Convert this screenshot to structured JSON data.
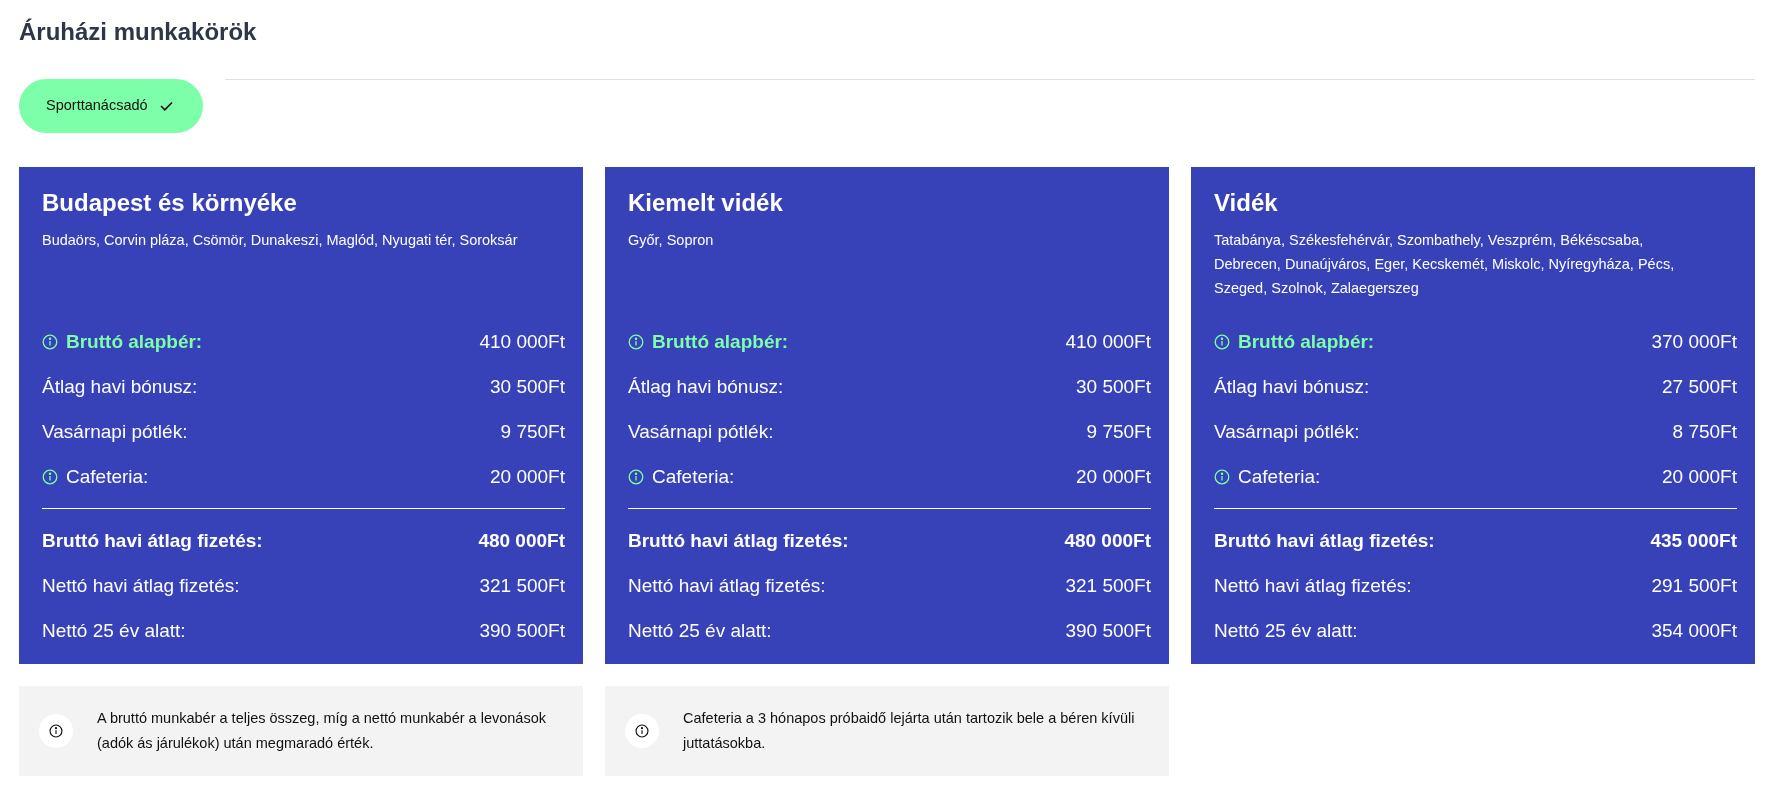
{
  "title": "Áruházi munkakörök",
  "roles": [
    {
      "label": "Sporttanácsadó",
      "selected": true
    }
  ],
  "regions": [
    {
      "name": "Budapest és környéke",
      "cities": "Budaörs, Corvin pláza, Csömör, Dunakeszi, Maglód, Nyugati tér, Soroksár",
      "rows": [
        {
          "kind": "base",
          "label": "Bruttó alapbér:",
          "value": "410 000Ft"
        },
        {
          "kind": "plain",
          "label": "Átlag havi bónusz:",
          "value": "30 500Ft"
        },
        {
          "kind": "plain",
          "label": "Vasárnapi pótlék:",
          "value": "9 750Ft"
        },
        {
          "kind": "info",
          "label": "Cafeteria:",
          "value": "20 000Ft"
        },
        {
          "kind": "total",
          "label": "Bruttó havi átlag fizetés:",
          "value": "480 000Ft"
        },
        {
          "kind": "plain",
          "label": "Nettó havi átlag fizetés:",
          "value": "321 500Ft"
        },
        {
          "kind": "plain",
          "label": "Nettó 25 év alatt:",
          "value": "390 500Ft"
        }
      ]
    },
    {
      "name": "Kiemelt vidék",
      "cities": "Győr, Sopron",
      "rows": [
        {
          "kind": "base",
          "label": "Bruttó alapbér:",
          "value": "410 000Ft"
        },
        {
          "kind": "plain",
          "label": "Átlag havi bónusz:",
          "value": "30 500Ft"
        },
        {
          "kind": "plain",
          "label": "Vasárnapi pótlék:",
          "value": "9 750Ft"
        },
        {
          "kind": "info",
          "label": "Cafeteria:",
          "value": "20 000Ft"
        },
        {
          "kind": "total",
          "label": "Bruttó havi átlag fizetés:",
          "value": "480 000Ft"
        },
        {
          "kind": "plain",
          "label": "Nettó havi átlag fizetés:",
          "value": "321 500Ft"
        },
        {
          "kind": "plain",
          "label": "Nettó 25 év alatt:",
          "value": "390 500Ft"
        }
      ]
    },
    {
      "name": "Vidék",
      "cities": "Tatabánya, Székesfehérvár, Szombathely, Veszprém, Békéscsaba, Debrecen, Dunaújváros, Eger, Kecskemét, Miskolc, Nyíregyháza, Pécs, Szeged, Szolnok, Zalaegerszeg",
      "rows": [
        {
          "kind": "base",
          "label": "Bruttó alapbér:",
          "value": "370 000Ft"
        },
        {
          "kind": "plain",
          "label": "Átlag havi bónusz:",
          "value": "27 500Ft"
        },
        {
          "kind": "plain",
          "label": "Vasárnapi pótlék:",
          "value": "8 750Ft"
        },
        {
          "kind": "info",
          "label": "Cafeteria:",
          "value": "20 000Ft"
        },
        {
          "kind": "total",
          "label": "Bruttó havi átlag fizetés:",
          "value": "435 000Ft"
        },
        {
          "kind": "plain",
          "label": "Nettó havi átlag fizetés:",
          "value": "291 500Ft"
        },
        {
          "kind": "plain",
          "label": "Nettó 25 év alatt:",
          "value": "354 000Ft"
        }
      ]
    }
  ],
  "notes": [
    "A bruttó munkabér a teljes összeg, míg a nettó munkabér a levonások (adók ás járulékok) után megmaradó érték.",
    "Cafeteria a 3 hónapos próbaidő lejárta után tartozik bele a béren kívüli juttatásokba."
  ]
}
